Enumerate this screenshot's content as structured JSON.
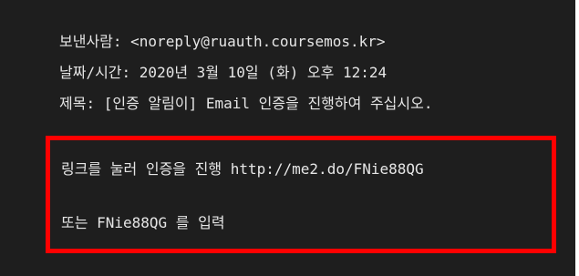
{
  "header": {
    "from_label": "보낸사람:",
    "from_value": "<noreply@ruauth.coursemos.kr>",
    "date_label": "날짜/시간:",
    "date_value": "2020년 3월 10일 (화) 오후 12:24",
    "subject_label": "제목:",
    "subject_value": "[인증 알림이] Email 인증을 진행하여 주십시오."
  },
  "body": {
    "link_line": "링크를 눌러 인증을 진행 http://me2.do/FNie88QG",
    "code_line": "또는 FNie88QG 를 입력"
  },
  "colors": {
    "background": "#1e1e1e",
    "text": "#e6e6e6",
    "highlight": "#ff0000"
  }
}
